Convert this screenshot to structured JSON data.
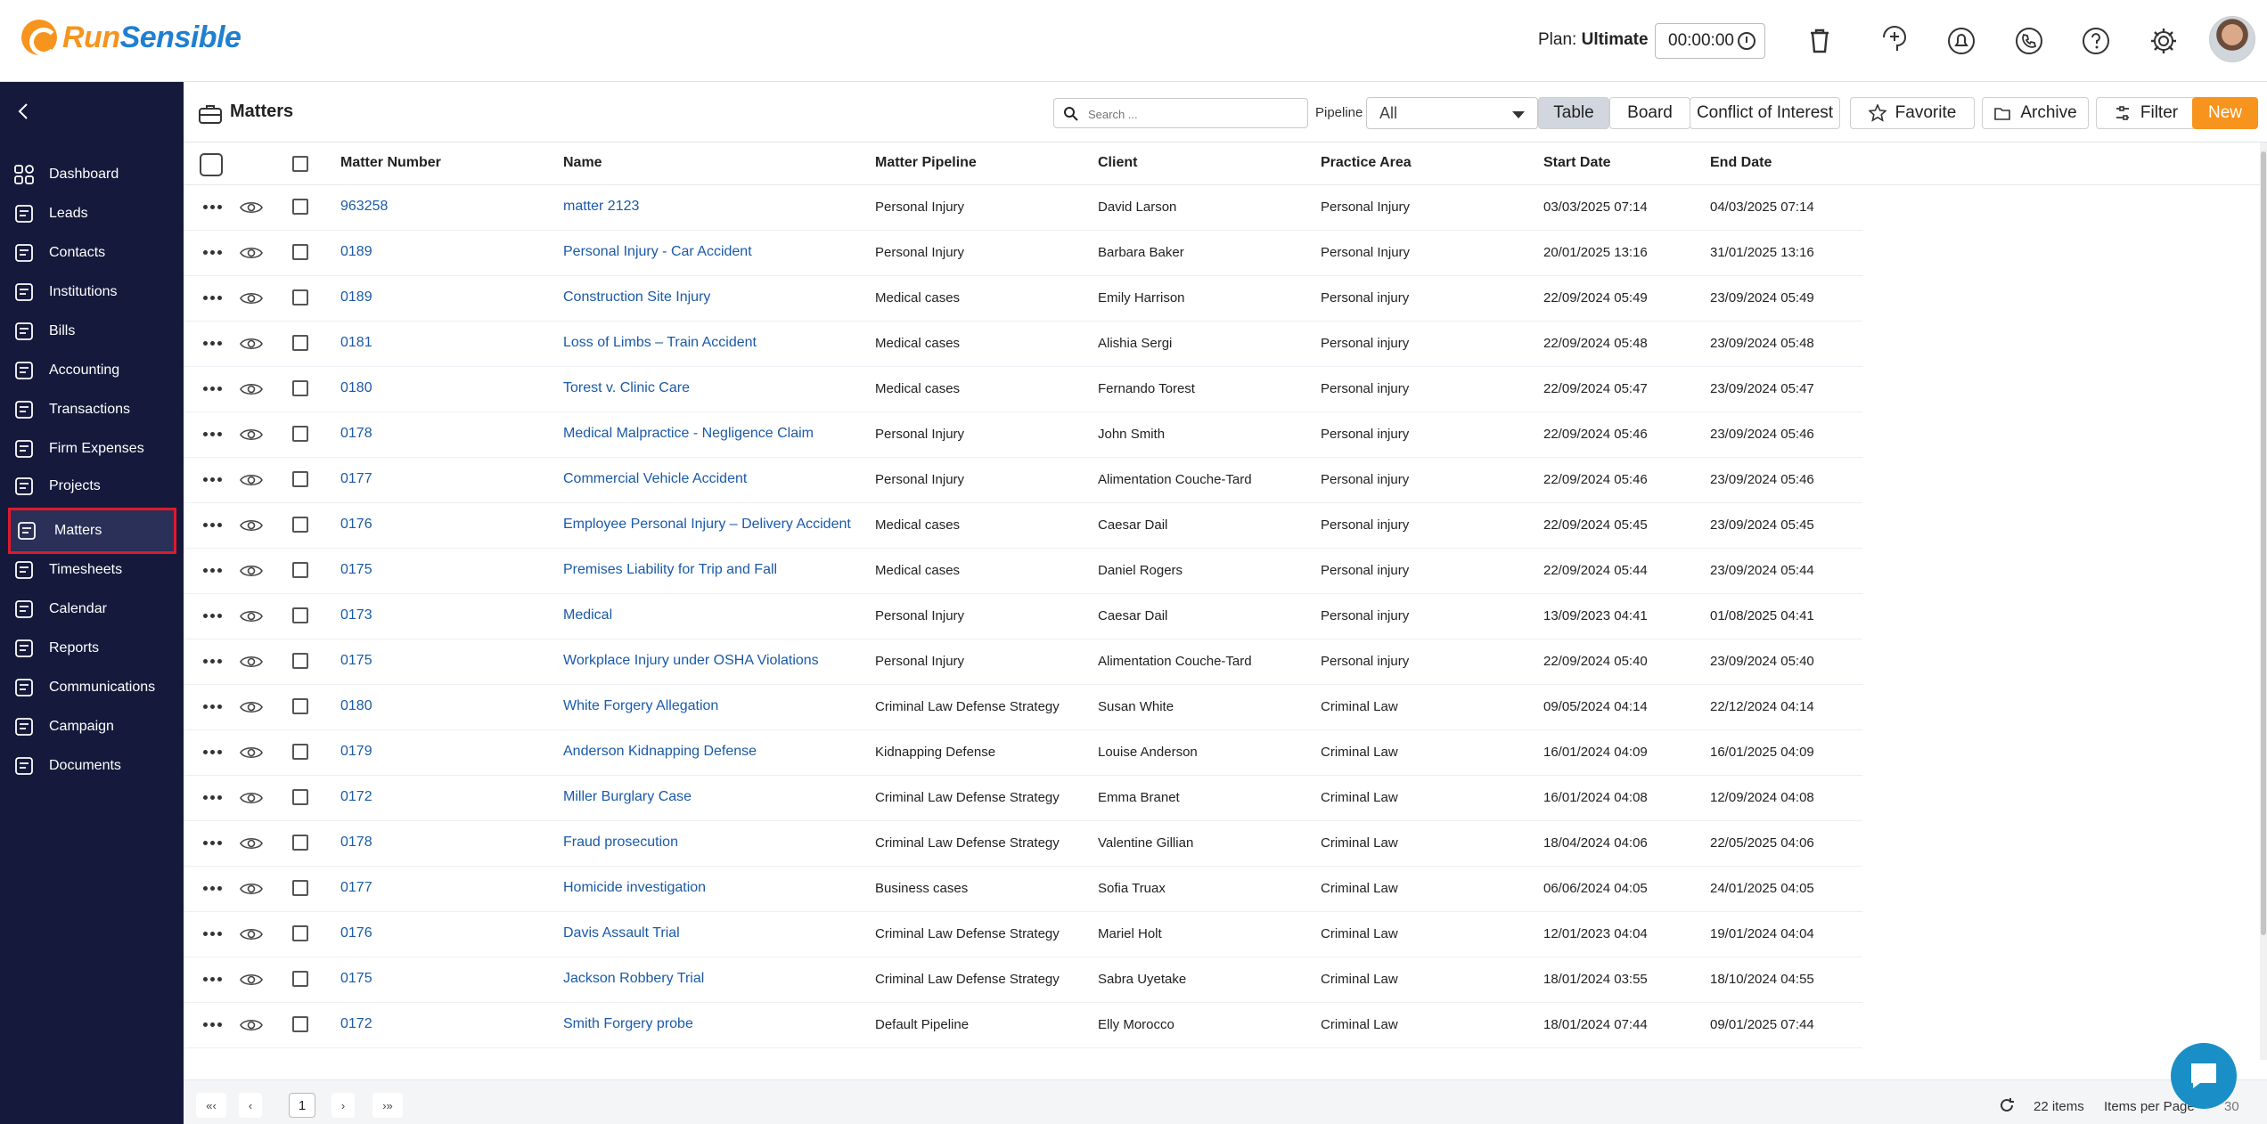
{
  "header": {
    "brand_part1": "Run",
    "brand_part2": "Sensible",
    "plan_label": "Plan:",
    "plan_value": "Ultimate",
    "timer_value": "00:00:00",
    "icons": [
      "trash-icon",
      "add-task-icon",
      "notifications-icon",
      "phone-icon",
      "help-icon",
      "settings-icon"
    ]
  },
  "sidebar": {
    "items": [
      {
        "label": "Dashboard",
        "icon": "dashboard-icon"
      },
      {
        "label": "Leads",
        "icon": "leads-icon"
      },
      {
        "label": "Contacts",
        "icon": "contacts-icon"
      },
      {
        "label": "Institutions",
        "icon": "institutions-icon"
      },
      {
        "label": "Bills",
        "icon": "bills-icon"
      },
      {
        "label": "Accounting",
        "icon": "accounting-icon"
      },
      {
        "label": "Transactions",
        "icon": "transactions-icon"
      },
      {
        "label": "Firm Expenses",
        "icon": "firm-expenses-icon"
      },
      {
        "label": "Projects",
        "icon": "projects-icon"
      },
      {
        "label": "Matters",
        "icon": "matters-icon",
        "active": true
      },
      {
        "label": "Timesheets",
        "icon": "timesheets-icon"
      },
      {
        "label": "Calendar",
        "icon": "calendar-icon"
      },
      {
        "label": "Reports",
        "icon": "reports-icon"
      },
      {
        "label": "Communications",
        "icon": "communications-icon"
      },
      {
        "label": "Campaign",
        "icon": "campaign-icon"
      },
      {
        "label": "Documents",
        "icon": "documents-icon"
      }
    ],
    "highlight_color": "#e0192a",
    "background": "#151a3c"
  },
  "toolbar": {
    "title": "Matters",
    "search_placeholder": "Search ...",
    "pipeline_label": "Pipeline",
    "pipeline_value": "All",
    "table_label": "Table",
    "board_label": "Board",
    "conflict_label": "Conflict of Interest",
    "favorite_label": "Favorite",
    "archive_label": "Archive",
    "filter_label": "Filter",
    "new_label": "New",
    "accent": "#f7941d"
  },
  "table": {
    "columns": [
      "Matter Number",
      "Name",
      "Matter Pipeline",
      "Client",
      "Practice Area",
      "Start Date",
      "End Date"
    ],
    "rows": [
      [
        "963258",
        "matter 2123",
        "Personal Injury",
        "David Larson",
        "Personal Injury",
        "03/03/2025 07:14",
        "04/03/2025 07:14"
      ],
      [
        "0189",
        "Personal Injury - Car Accident",
        "Personal Injury",
        "Barbara Baker",
        "Personal Injury",
        "20/01/2025 13:16",
        "31/01/2025 13:16"
      ],
      [
        "0189",
        "Construction Site Injury",
        "Medical cases",
        "Emily Harrison",
        "Personal injury",
        "22/09/2024 05:49",
        "23/09/2024 05:49"
      ],
      [
        "0181",
        "Loss of Limbs – Train Accident",
        "Medical cases",
        "Alishia Sergi",
        "Personal injury",
        "22/09/2024 05:48",
        "23/09/2024 05:48"
      ],
      [
        "0180",
        "Torest v. Clinic Care",
        "Medical cases",
        "Fernando Torest",
        "Personal injury",
        "22/09/2024 05:47",
        "23/09/2024 05:47"
      ],
      [
        "0178",
        "Medical Malpractice - Negligence Claim",
        "Personal Injury",
        "John Smith",
        "Personal injury",
        "22/09/2024 05:46",
        "23/09/2024 05:46"
      ],
      [
        "0177",
        "Commercial Vehicle Accident",
        "Personal Injury",
        "Alimentation Couche-Tard",
        "Personal injury",
        "22/09/2024 05:46",
        "23/09/2024 05:46"
      ],
      [
        "0176",
        "Employee Personal Injury – Delivery Accident",
        "Medical cases",
        "Caesar Dail",
        "Personal injury",
        "22/09/2024 05:45",
        "23/09/2024 05:45"
      ],
      [
        "0175",
        "Premises Liability for Trip and Fall",
        "Medical cases",
        "Daniel Rogers",
        "Personal injury",
        "22/09/2024 05:44",
        "23/09/2024 05:44"
      ],
      [
        "0173",
        "Medical",
        "Personal Injury",
        "Caesar Dail",
        "Personal injury",
        "13/09/2023 04:41",
        "01/08/2025 04:41"
      ],
      [
        "0175",
        "Workplace Injury under OSHA Violations",
        "Personal Injury",
        "Alimentation Couche-Tard",
        "Personal injury",
        "22/09/2024 05:40",
        "23/09/2024 05:40"
      ],
      [
        "0180",
        "White Forgery Allegation",
        "Criminal Law Defense Strategy",
        "Susan White",
        "Criminal Law",
        "09/05/2024 04:14",
        "22/12/2024 04:14"
      ],
      [
        "0179",
        "Anderson Kidnapping Defense",
        "Kidnapping Defense",
        "Louise Anderson",
        "Criminal Law",
        "16/01/2024 04:09",
        "16/01/2025 04:09"
      ],
      [
        "0172",
        "Miller Burglary Case",
        "Criminal Law Defense Strategy",
        "Emma Branet",
        "Criminal Law",
        "16/01/2024 04:08",
        "12/09/2024 04:08"
      ],
      [
        "0178",
        "Fraud prosecution",
        "Criminal Law Defense Strategy",
        "Valentine Gillian",
        "Criminal Law",
        "18/04/2024 04:06",
        "22/05/2025 04:06"
      ],
      [
        "0177",
        "Homicide investigation",
        "Business cases",
        "Sofia Truax",
        "Criminal Law",
        "06/06/2024 04:05",
        "24/01/2025 04:05"
      ],
      [
        "0176",
        "Davis Assault Trial",
        "Criminal Law Defense Strategy",
        "Mariel Holt",
        "Criminal Law",
        "12/01/2023 04:04",
        "19/01/2024 04:04"
      ],
      [
        "0175",
        "Jackson Robbery Trial",
        "Criminal Law Defense Strategy",
        "Sabra Uyetake",
        "Criminal Law",
        "18/01/2024 03:55",
        "18/10/2024 04:55"
      ],
      [
        "0172",
        "Smith Forgery probe",
        "Default Pipeline",
        "Elly Morocco",
        "Criminal Law",
        "18/01/2024 07:44",
        "09/01/2025 07:44"
      ]
    ],
    "link_color": "#1a5aa8"
  },
  "pager": {
    "first": "«‹",
    "prev": "‹",
    "current_page": "1",
    "next": "›",
    "last": "›»",
    "items_count": "22 items",
    "per_page_label": "Items per Page",
    "per_page_value": "30"
  }
}
